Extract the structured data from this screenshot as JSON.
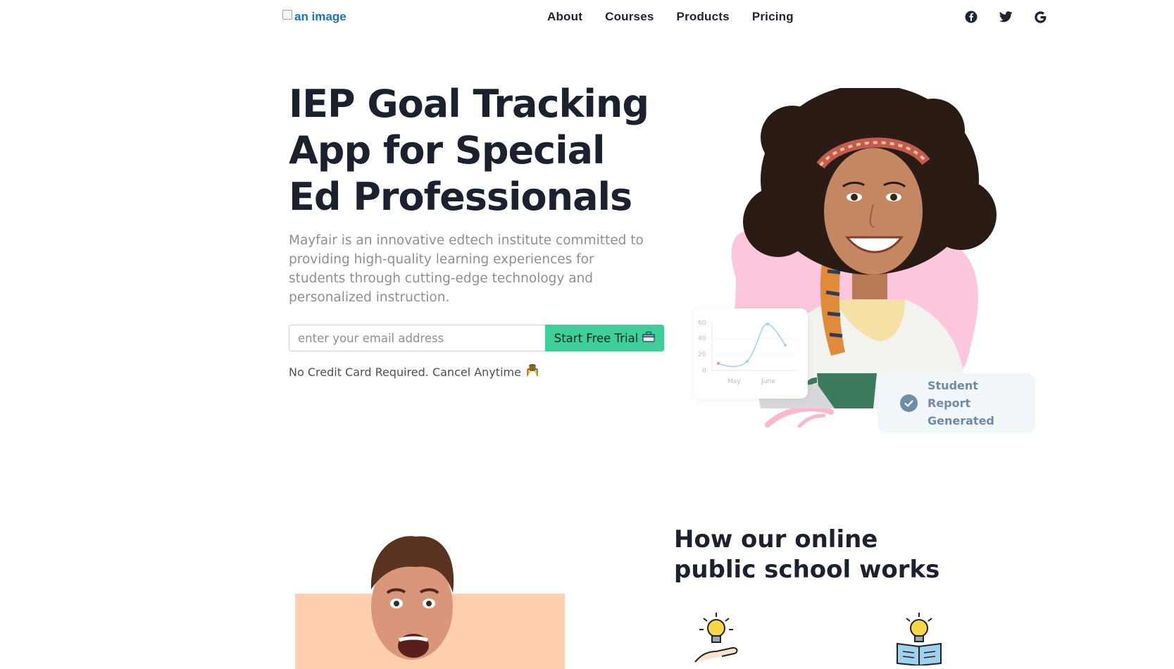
{
  "nav": {
    "logo_alt": "an image",
    "links": [
      "About",
      "Courses",
      "Products",
      "Pricing"
    ],
    "social": [
      "facebook-icon",
      "twitter-icon",
      "google-icon"
    ]
  },
  "hero": {
    "title": "IEP Goal Tracking App for Special Ed Professionals",
    "description": "Mayfair is an innovative edtech institute committed to providing high-quality learning experiences for students through cutting-edge technology and personalized instruction.",
    "email_placeholder": "enter your email address",
    "cta_label": "Start Free Trial",
    "note": "No Credit Card Required. Cancel Anytime",
    "report_card": "Student Report Generated",
    "mini_chart": {
      "y_ticks": [
        "60",
        "40",
        "20",
        "0"
      ],
      "x_ticks": [
        "May",
        "June"
      ]
    }
  },
  "section2": {
    "title": "How our online public school works"
  },
  "colors": {
    "accent": "#3fcf9b",
    "heading": "#1c2130",
    "muted": "#8a8f98",
    "logo": "#1a6fd6",
    "pink": "#f9b3cf",
    "report": "#6f8aa2"
  }
}
